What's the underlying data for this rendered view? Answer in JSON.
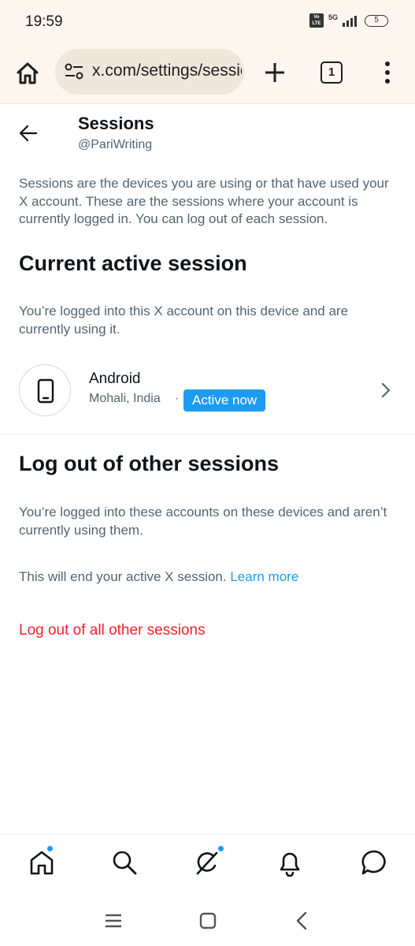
{
  "status_bar": {
    "time": "19:59",
    "volte": "Vo LTE",
    "network": "5G",
    "battery": "5"
  },
  "browser": {
    "url": "x.com/settings/sessions",
    "tab_count": "1"
  },
  "header": {
    "title": "Sessions",
    "handle": "@PariWriting"
  },
  "intro": "Sessions are the devices you are using or that have used your X account. These are the sessions where your account is currently logged in. You can log out of each session.",
  "current_session": {
    "title": "Current active session",
    "description": "You’re logged into this X account on this device and are currently using it.",
    "device": {
      "name": "Android",
      "location": "Mohali, India",
      "separator": "·",
      "badge": "Active now"
    }
  },
  "other_sessions": {
    "title": "Log out of other sessions",
    "description": "You’re logged into these accounts on these devices and aren’t currently using them.",
    "end_notice": "This will end your active X session.",
    "learn_more": "Learn more",
    "logout_all": "Log out of all other sessions"
  },
  "bottom_nav": {
    "items": [
      "home-icon",
      "search-icon",
      "grok-icon",
      "notifications-icon",
      "messages-icon"
    ]
  },
  "colors": {
    "accent": "#1d9bf0",
    "danger": "#f4212e",
    "secondary_text": "#536471",
    "browser_bar": "#fdf6ee"
  }
}
